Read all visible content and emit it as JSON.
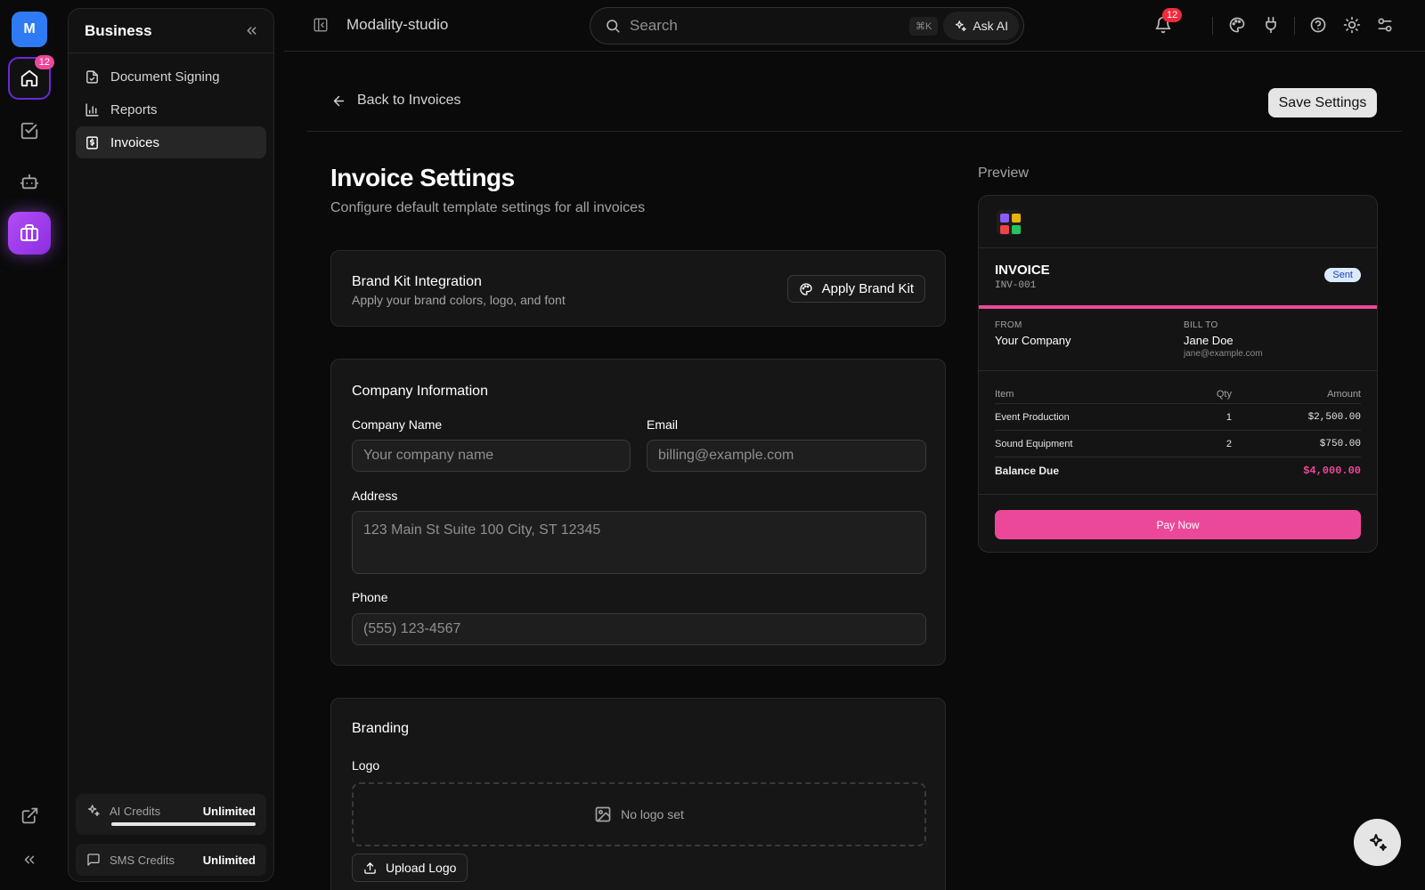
{
  "rail": {
    "avatar_initial": "M",
    "home_badge": "12"
  },
  "sidebar": {
    "title": "Business",
    "items": [
      {
        "label": "Document Signing",
        "icon": "document-signing-icon"
      },
      {
        "label": "Reports",
        "icon": "bar-chart-icon"
      },
      {
        "label": "Invoices",
        "icon": "invoice-icon",
        "active": true
      }
    ],
    "ai_credits": {
      "label": "AI Credits",
      "value": "Unlimited",
      "fill_fraction": 1.0
    },
    "sms_credits": {
      "label": "SMS Credits",
      "value": "Unlimited"
    }
  },
  "topbar": {
    "workspace": "Modality-studio",
    "search_placeholder": "Search",
    "shortcut": "⌘K",
    "ask_ai": "Ask AI",
    "notification_count": "12"
  },
  "header": {
    "back_label": "Back to Invoices",
    "save_label": "Save Settings"
  },
  "page": {
    "title": "Invoice Settings",
    "subtitle": "Configure default template settings for all invoices"
  },
  "brand_kit": {
    "title": "Brand Kit Integration",
    "subtitle": "Apply your brand colors, logo, and font",
    "button": "Apply Brand Kit"
  },
  "company": {
    "title": "Company Information",
    "name_label": "Company Name",
    "name_placeholder": "Your company name",
    "email_label": "Email",
    "email_placeholder": "billing@example.com",
    "address_label": "Address",
    "address_placeholder": "123 Main St Suite 100 City, ST 12345",
    "phone_label": "Phone",
    "phone_placeholder": "(555) 123-4567"
  },
  "branding": {
    "title": "Branding",
    "logo_label": "Logo",
    "no_logo": "No logo set",
    "upload": "Upload Logo"
  },
  "preview": {
    "label": "Preview",
    "logo_colors": [
      "#8b5cf6",
      "#eab308",
      "#ef4444",
      "#22c55e"
    ],
    "invoice_title": "INVOICE",
    "invoice_number": "INV-001",
    "status": "Sent",
    "accent_color": "#ec4899",
    "from_label": "FROM",
    "from_name": "Your Company",
    "bill_to_label": "BILL TO",
    "bill_to_name": "Jane Doe",
    "bill_to_email": "jane@example.com",
    "columns": [
      "Item",
      "Qty",
      "Amount"
    ],
    "rows": [
      {
        "item": "Event Production",
        "qty": "1",
        "amount": "$2,500.00"
      },
      {
        "item": "Sound Equipment",
        "qty": "2",
        "amount": "$750.00"
      }
    ],
    "balance_label": "Balance Due",
    "balance_value": "$4,000.00",
    "pay_button": "Pay Now"
  }
}
